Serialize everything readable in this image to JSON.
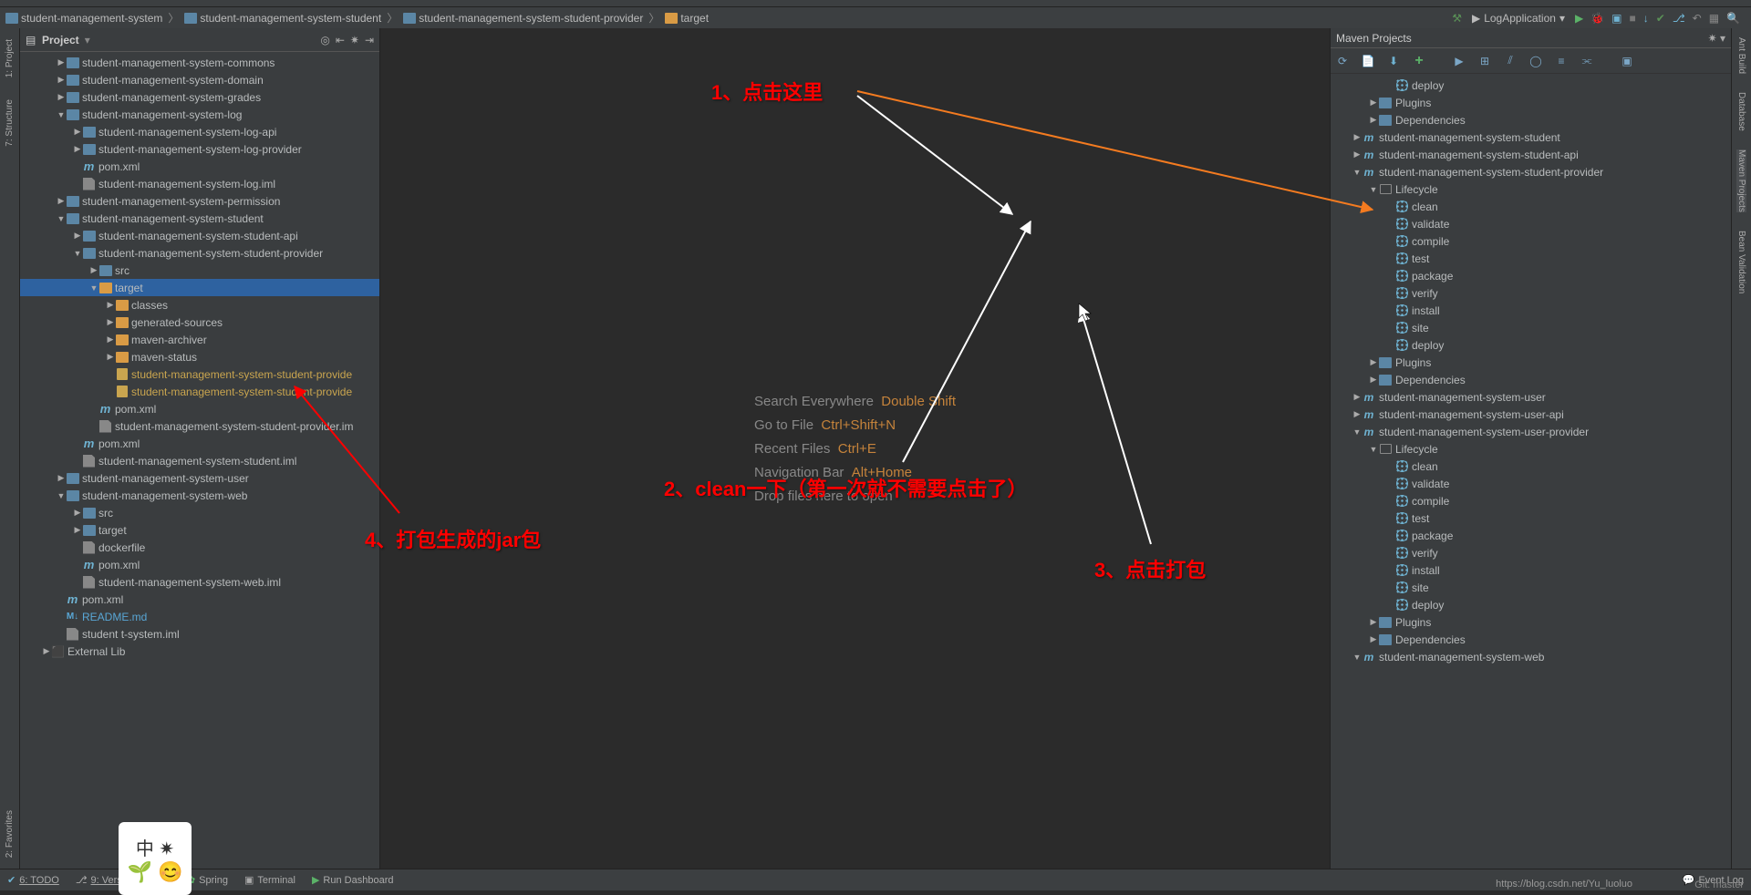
{
  "breadcrumb": {
    "items": [
      "student-management-system",
      "student-management-system-student",
      "student-management-system-student-provider",
      "target"
    ]
  },
  "run_config": "LogApplication",
  "project_panel": {
    "title": "Project",
    "tree": [
      {
        "indent": 0,
        "arrow": "▶",
        "icon": "folder",
        "label": "student-management-system-commons"
      },
      {
        "indent": 0,
        "arrow": "▶",
        "icon": "folder",
        "label": "student-management-system-domain"
      },
      {
        "indent": 0,
        "arrow": "▶",
        "icon": "folder",
        "label": "student-management-system-grades"
      },
      {
        "indent": 0,
        "arrow": "▼",
        "icon": "folder",
        "label": "student-management-system-log"
      },
      {
        "indent": 1,
        "arrow": "▶",
        "icon": "folder",
        "label": "student-management-system-log-api"
      },
      {
        "indent": 1,
        "arrow": "▶",
        "icon": "folder",
        "label": "student-management-system-log-provider"
      },
      {
        "indent": 1,
        "arrow": "",
        "icon": "m",
        "label": "pom.xml"
      },
      {
        "indent": 1,
        "arrow": "",
        "icon": "file",
        "label": "student-management-system-log.iml"
      },
      {
        "indent": 0,
        "arrow": "▶",
        "icon": "folder",
        "label": "student-management-system-permission"
      },
      {
        "indent": 0,
        "arrow": "▼",
        "icon": "folder",
        "label": "student-management-system-student"
      },
      {
        "indent": 1,
        "arrow": "▶",
        "icon": "folder",
        "label": "student-management-system-student-api"
      },
      {
        "indent": 1,
        "arrow": "▼",
        "icon": "folder",
        "label": "student-management-system-student-provider"
      },
      {
        "indent": 2,
        "arrow": "▶",
        "icon": "folder",
        "label": "src"
      },
      {
        "indent": 2,
        "arrow": "▼",
        "icon": "folder-orange",
        "label": "target",
        "selected": true
      },
      {
        "indent": 3,
        "arrow": "▶",
        "icon": "folder-orange",
        "label": "classes"
      },
      {
        "indent": 3,
        "arrow": "▶",
        "icon": "folder-orange",
        "label": "generated-sources"
      },
      {
        "indent": 3,
        "arrow": "▶",
        "icon": "folder-orange",
        "label": "maven-archiver"
      },
      {
        "indent": 3,
        "arrow": "▶",
        "icon": "folder-orange",
        "label": "maven-status"
      },
      {
        "indent": 3,
        "arrow": "",
        "icon": "jar",
        "label": "student-management-system-student-provide",
        "cls": "artifact"
      },
      {
        "indent": 3,
        "arrow": "",
        "icon": "jar",
        "label": "student-management-system-student-provide",
        "cls": "artifact"
      },
      {
        "indent": 2,
        "arrow": "",
        "icon": "m",
        "label": "pom.xml"
      },
      {
        "indent": 2,
        "arrow": "",
        "icon": "file",
        "label": "student-management-system-student-provider.im"
      },
      {
        "indent": 1,
        "arrow": "",
        "icon": "m",
        "label": "pom.xml"
      },
      {
        "indent": 1,
        "arrow": "",
        "icon": "file",
        "label": "student-management-system-student.iml"
      },
      {
        "indent": 0,
        "arrow": "▶",
        "icon": "folder",
        "label": "student-management-system-user"
      },
      {
        "indent": 0,
        "arrow": "▼",
        "icon": "folder",
        "label": "student-management-system-web"
      },
      {
        "indent": 1,
        "arrow": "▶",
        "icon": "folder",
        "label": "src"
      },
      {
        "indent": 1,
        "arrow": "▶",
        "icon": "folder",
        "label": "target"
      },
      {
        "indent": 1,
        "arrow": "",
        "icon": "file",
        "label": "dockerfile"
      },
      {
        "indent": 1,
        "arrow": "",
        "icon": "m",
        "label": "pom.xml"
      },
      {
        "indent": 1,
        "arrow": "",
        "icon": "file",
        "label": "student-management-system-web.iml"
      },
      {
        "indent": 0,
        "arrow": "",
        "icon": "m",
        "label": "pom.xml"
      },
      {
        "indent": 0,
        "arrow": "",
        "icon": "md",
        "label": "README.md",
        "fg": "#59a7d6"
      },
      {
        "indent": 0,
        "arrow": "",
        "icon": "file",
        "label": "student               t-system.iml"
      },
      {
        "indent": -1,
        "arrow": "▶",
        "icon": "lib",
        "label": "External Lib"
      }
    ]
  },
  "welcome": [
    {
      "text": "Search Everywhere",
      "shortcut": "Double Shift"
    },
    {
      "text": "Go to File",
      "shortcut": "Ctrl+Shift+N"
    },
    {
      "text": "Recent Files",
      "shortcut": "Ctrl+E"
    },
    {
      "text": "Navigation Bar",
      "shortcut": "Alt+Home"
    },
    {
      "text": "Drop files here to open",
      "shortcut": ""
    }
  ],
  "maven_panel": {
    "title": "Maven Projects",
    "tree": [
      {
        "indent": 3,
        "arrow": "",
        "icon": "gear",
        "label": "deploy"
      },
      {
        "indent": 2,
        "arrow": "▶",
        "icon": "folder",
        "label": "Plugins"
      },
      {
        "indent": 2,
        "arrow": "▶",
        "icon": "folder",
        "label": "Dependencies"
      },
      {
        "indent": 1,
        "arrow": "▶",
        "icon": "mproj",
        "label": "student-management-system-student"
      },
      {
        "indent": 1,
        "arrow": "▶",
        "icon": "mproj",
        "label": "student-management-system-student-api"
      },
      {
        "indent": 1,
        "arrow": "▼",
        "icon": "mproj",
        "label": "student-management-system-student-provider"
      },
      {
        "indent": 2,
        "arrow": "▼",
        "icon": "lifecycle",
        "label": "Lifecycle"
      },
      {
        "indent": 3,
        "arrow": "",
        "icon": "gear",
        "label": "clean"
      },
      {
        "indent": 3,
        "arrow": "",
        "icon": "gear",
        "label": "validate"
      },
      {
        "indent": 3,
        "arrow": "",
        "icon": "gear",
        "label": "compile"
      },
      {
        "indent": 3,
        "arrow": "",
        "icon": "gear",
        "label": "test"
      },
      {
        "indent": 3,
        "arrow": "",
        "icon": "gear",
        "label": "package"
      },
      {
        "indent": 3,
        "arrow": "",
        "icon": "gear",
        "label": "verify"
      },
      {
        "indent": 3,
        "arrow": "",
        "icon": "gear",
        "label": "install"
      },
      {
        "indent": 3,
        "arrow": "",
        "icon": "gear",
        "label": "site"
      },
      {
        "indent": 3,
        "arrow": "",
        "icon": "gear",
        "label": "deploy"
      },
      {
        "indent": 2,
        "arrow": "▶",
        "icon": "folder",
        "label": "Plugins"
      },
      {
        "indent": 2,
        "arrow": "▶",
        "icon": "folder",
        "label": "Dependencies"
      },
      {
        "indent": 1,
        "arrow": "▶",
        "icon": "mproj",
        "label": "student-management-system-user"
      },
      {
        "indent": 1,
        "arrow": "▶",
        "icon": "mproj",
        "label": "student-management-system-user-api"
      },
      {
        "indent": 1,
        "arrow": "▼",
        "icon": "mproj",
        "label": "student-management-system-user-provider"
      },
      {
        "indent": 2,
        "arrow": "▼",
        "icon": "lifecycle",
        "label": "Lifecycle"
      },
      {
        "indent": 3,
        "arrow": "",
        "icon": "gear",
        "label": "clean"
      },
      {
        "indent": 3,
        "arrow": "",
        "icon": "gear",
        "label": "validate"
      },
      {
        "indent": 3,
        "arrow": "",
        "icon": "gear",
        "label": "compile"
      },
      {
        "indent": 3,
        "arrow": "",
        "icon": "gear",
        "label": "test"
      },
      {
        "indent": 3,
        "arrow": "",
        "icon": "gear",
        "label": "package"
      },
      {
        "indent": 3,
        "arrow": "",
        "icon": "gear",
        "label": "verify"
      },
      {
        "indent": 3,
        "arrow": "",
        "icon": "gear",
        "label": "install"
      },
      {
        "indent": 3,
        "arrow": "",
        "icon": "gear",
        "label": "site"
      },
      {
        "indent": 3,
        "arrow": "",
        "icon": "gear",
        "label": "deploy"
      },
      {
        "indent": 2,
        "arrow": "▶",
        "icon": "folder",
        "label": "Plugins"
      },
      {
        "indent": 2,
        "arrow": "▶",
        "icon": "folder",
        "label": "Dependencies"
      },
      {
        "indent": 1,
        "arrow": "▼",
        "icon": "mproj",
        "label": "student-management-system-web"
      }
    ]
  },
  "left_gutter": [
    "1: Project",
    "7: Structure",
    "2: Favorites"
  ],
  "right_gutter": [
    "Ant Build",
    "Database",
    "Maven Projects",
    "Bean Validation"
  ],
  "bottom_bar": {
    "items": [
      "6: TODO",
      "9: Version Control",
      "Spring",
      "Terminal",
      "Run Dashboard"
    ],
    "right": [
      "Event Log"
    ],
    "git": "Git: master"
  },
  "annotations": {
    "a1": "1、点击这里",
    "a2": "2、clean一下（第一次就不需要点击了）",
    "a3": "3、点击打包",
    "a4": "4、打包生成的jar包"
  },
  "watermark": "https://blog.csdn.net/Yu_luoluo"
}
